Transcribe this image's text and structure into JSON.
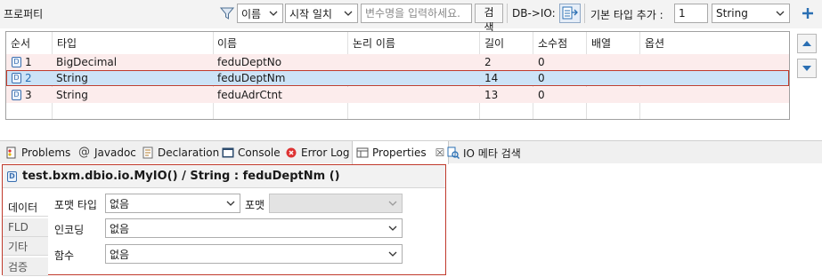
{
  "toolbar": {
    "panel_title": "프로퍼티",
    "filter_field": "이름",
    "match_mode": "시작 일치",
    "search_placeholder": "변수명을 입력하세요.",
    "search_label": "검색",
    "db_io_label": "DB->IO:",
    "base_type_label": "기본 타입 추가 :",
    "count_value": "1",
    "type_value": "String"
  },
  "table": {
    "columns": [
      "순서",
      "타입",
      "이름",
      "논리 이름",
      "길이",
      "소수점",
      "배열",
      "옵션"
    ],
    "rows": [
      {
        "order": "1",
        "type": "BigDecimal",
        "name": "feduDeptNo",
        "logical": "",
        "length": "2",
        "decimal": "0",
        "array": "",
        "option": ""
      },
      {
        "order": "2",
        "type": "String",
        "name": "feduDeptNm",
        "logical": "",
        "length": "14",
        "decimal": "0",
        "array": "",
        "option": ""
      },
      {
        "order": "3",
        "type": "String",
        "name": "feduAdrCtnt",
        "logical": "",
        "length": "13",
        "decimal": "0",
        "array": "",
        "option": ""
      }
    ],
    "badge": "D"
  },
  "tabs": [
    {
      "label": "Problems",
      "icon": "problems-icon"
    },
    {
      "label": "Javadoc",
      "icon": "at-icon"
    },
    {
      "label": "Declaration",
      "icon": "declaration-icon"
    },
    {
      "label": "Console",
      "icon": "console-icon"
    },
    {
      "label": "Error Log",
      "icon": "error-log-icon"
    },
    {
      "label": "Properties",
      "icon": "properties-icon"
    },
    {
      "label": "IO 메타 검색",
      "icon": "io-search-icon"
    }
  ],
  "properties": {
    "title": "test.bxm.dbio.io.MyIO() / String : feduDeptNm ()",
    "side_tabs": [
      "데이터",
      "FLD",
      "기타",
      "검증"
    ],
    "format_type_label": "포맷 타입",
    "format_type_value": "없음",
    "format_label": "포맷",
    "format_value": "",
    "encoding_label": "인코딩",
    "encoding_value": "없음",
    "function_label": "함수",
    "function_value": "없음"
  },
  "colors": {
    "selection": "#cce3f7",
    "row_tint": "#fcecec",
    "highlight_border": "#c0392b",
    "accent": "#2a6fb3"
  }
}
